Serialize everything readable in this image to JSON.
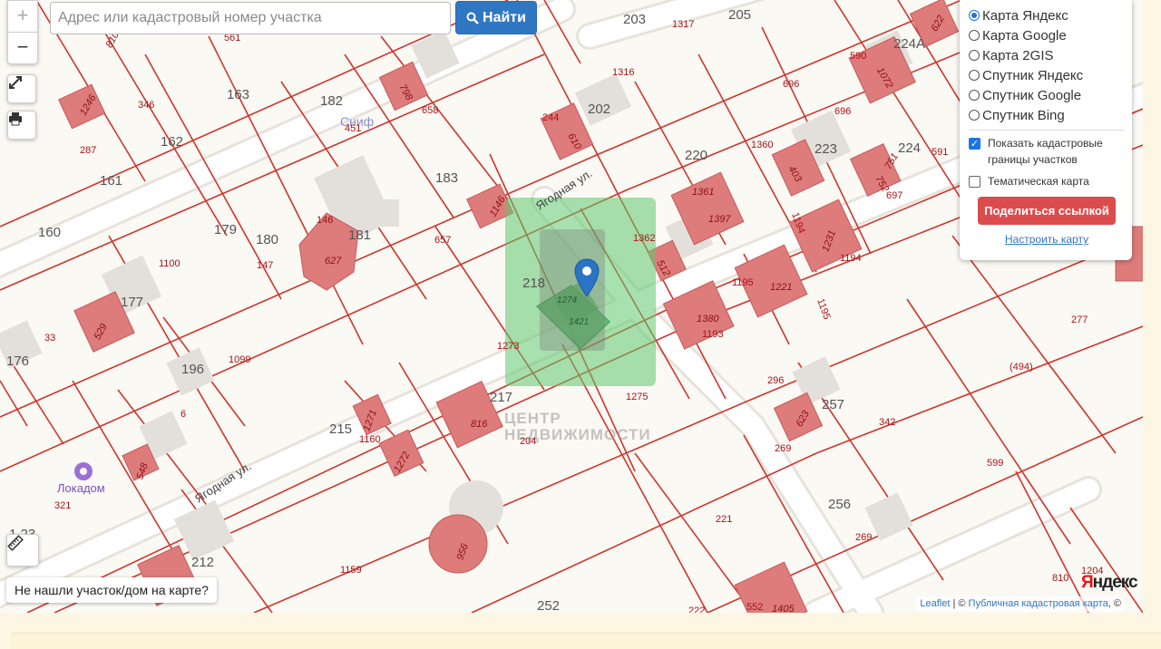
{
  "search": {
    "placeholder": "Адрес или кадастровый номер участка",
    "button_label": "Найти"
  },
  "controls": {
    "zoom_in": "+",
    "zoom_out": "−"
  },
  "layers": {
    "options": [
      "Карта Яндекс",
      "Карта Google",
      "Карта 2GIS",
      "Спутник Яндекс",
      "Спутник Google",
      "Спутник Bing"
    ],
    "selected": "Карта Яндекс",
    "show_cadastral": "Показать кадастровые границы участков",
    "show_cadastral_checked": true,
    "thematic": "Тематическая карта",
    "thematic_checked": false,
    "share_button": "Поделиться ссылкой",
    "configure_link": "Настроить карту"
  },
  "not_found_label": "Не нашли участок/дом на карте?",
  "attribution": {
    "leaflet": "Leaflet",
    "separator": " | © ",
    "cadastre": "Публичная кадастровая карта",
    "tail": ", ©"
  },
  "yandex_logo": {
    "first": "Я",
    "rest": "ндекс"
  },
  "map": {
    "streets": [
      "Ягодная ул.",
      "Ягодная ул."
    ],
    "poi": [
      "Сниф",
      "Локадом"
    ],
    "watermark": [
      "ЦЕНТР",
      "НЕДВИЖИМОСТИ"
    ],
    "house_numbers": [
      "205",
      "203",
      "224А",
      "182",
      "163",
      "162",
      "161",
      "160",
      "180",
      "179",
      "181",
      "183",
      "202",
      "220",
      "223",
      "224",
      "218",
      "217",
      "177",
      "176",
      "196",
      "215",
      "212",
      "257",
      "256",
      "252",
      "1.23"
    ],
    "parcel_numbers": [
      "561",
      "1317",
      "1316",
      "696",
      "590",
      "696",
      "346",
      "287",
      "451",
      "658",
      "244",
      "1360",
      "591",
      "697",
      "1194",
      "1100",
      "147",
      "657",
      "1362",
      "1195",
      "1193",
      "1195",
      "1194",
      "33",
      "1099",
      "1273",
      "1275",
      "296",
      "342",
      "277",
      "(494)",
      "6",
      "1160",
      "204",
      "269",
      "599",
      "321",
      "1159",
      "221",
      "269",
      "1204",
      "810",
      "552",
      "222"
    ],
    "building_numbers": [
      "810",
      "1246",
      "798",
      "610",
      "403",
      "751",
      "752",
      "1072",
      "622",
      "1146",
      "1361",
      "1397",
      "1231",
      "146",
      "627",
      "1274",
      "1421",
      "512",
      "1221",
      "529",
      "1380",
      "623",
      "1271",
      "1272",
      "816",
      "548",
      "956",
      "1405"
    ]
  },
  "colors": {
    "parcel_border": "#d0342c",
    "building_fill": "#de7b7b",
    "road": "#ffffff",
    "highlight": "#6fd07c",
    "pin": "#2a73c5"
  }
}
